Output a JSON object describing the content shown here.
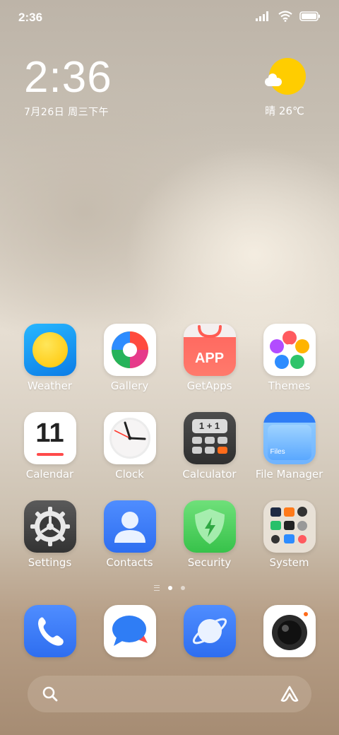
{
  "status": {
    "time": "2:36"
  },
  "clock_widget": {
    "time": "2:36",
    "date": "7月26日 周三下午"
  },
  "weather_widget": {
    "text": "晴 26℃"
  },
  "apps": [
    {
      "label": "Weather"
    },
    {
      "label": "Gallery"
    },
    {
      "label": "GetApps"
    },
    {
      "label": "Themes"
    },
    {
      "label": "Calendar"
    },
    {
      "label": "Clock"
    },
    {
      "label": "Calculator"
    },
    {
      "label": "File Manager"
    },
    {
      "label": "Settings"
    },
    {
      "label": "Contacts"
    },
    {
      "label": "Security"
    },
    {
      "label": "System"
    }
  ],
  "icon_text": {
    "getapps": "APP",
    "calendar_day": "11",
    "calculator": "1 + 1",
    "files": "Files"
  },
  "dock": [
    {
      "name": "phone"
    },
    {
      "name": "messages"
    },
    {
      "name": "browser"
    },
    {
      "name": "camera"
    }
  ],
  "pager": {
    "current": 2,
    "total": 2
  },
  "colors": {
    "weather_sun": "#ffcd00",
    "accent_blue": "#3a7bf2",
    "security_green": "#4cd05a"
  }
}
